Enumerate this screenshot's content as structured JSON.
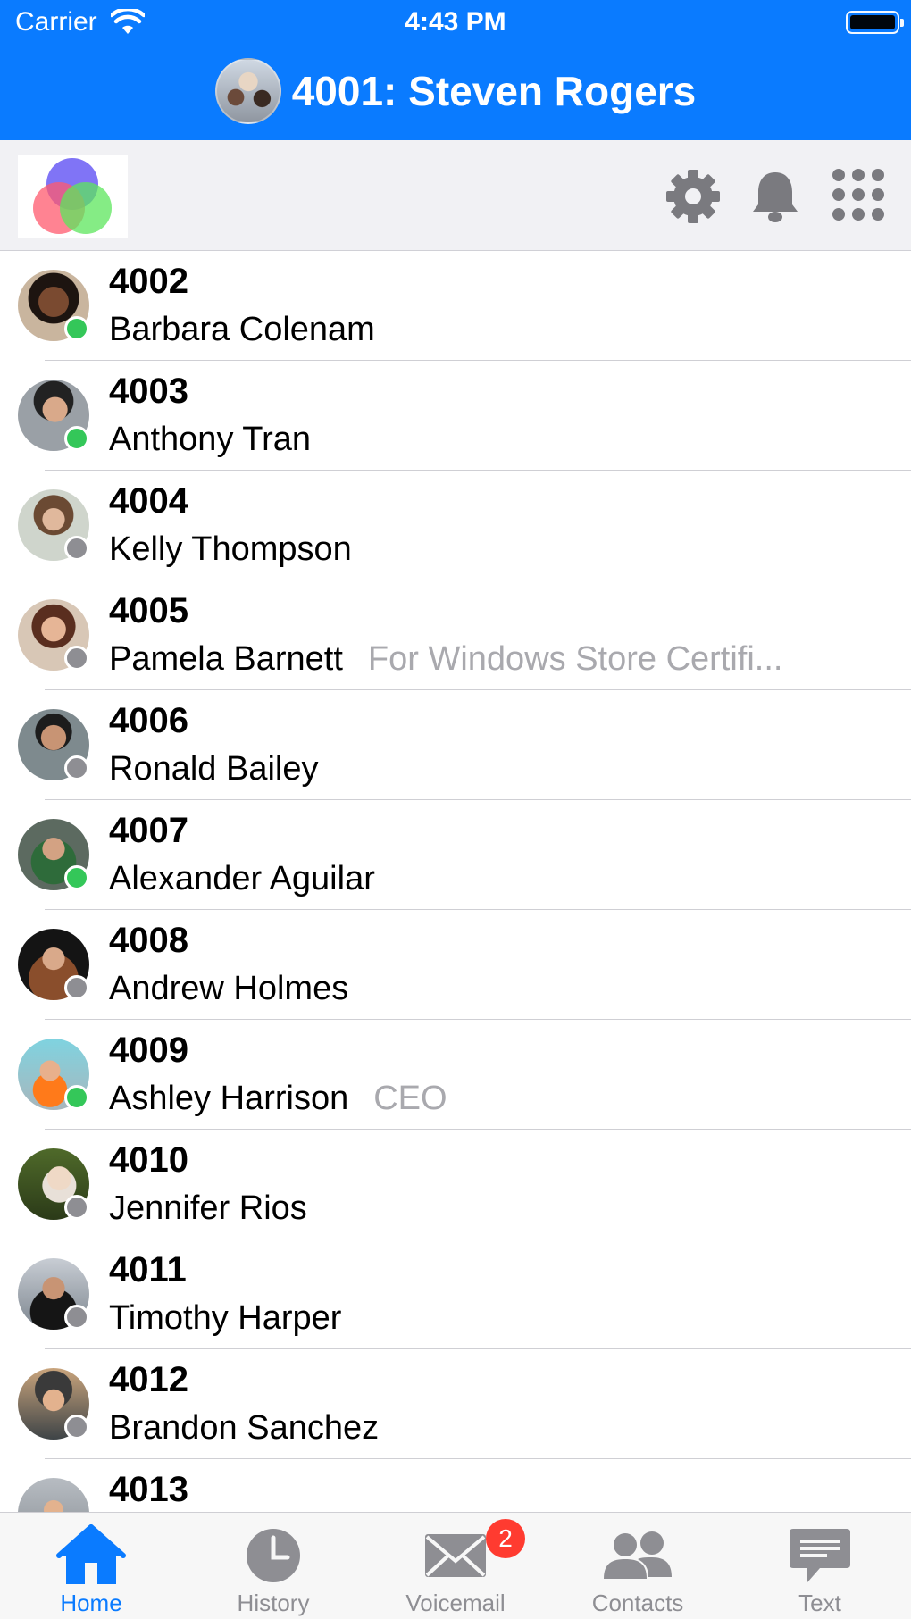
{
  "status_bar": {
    "carrier": "Carrier",
    "time": "4:43 PM"
  },
  "header": {
    "title": "4001: Steven Rogers"
  },
  "toolbar": {
    "icons": [
      "logo-icon",
      "gear-icon",
      "bell-icon",
      "dialpad-icon"
    ]
  },
  "colors": {
    "accent": "#0a7bff",
    "online": "#34c759",
    "offline": "#8e8e93",
    "badge": "#ff3b30"
  },
  "contacts": [
    {
      "ext": "4002",
      "name": "Barbara Colenam",
      "note": "",
      "status": "online"
    },
    {
      "ext": "4003",
      "name": "Anthony Tran",
      "note": "",
      "status": "online"
    },
    {
      "ext": "4004",
      "name": "Kelly Thompson",
      "note": "",
      "status": "offline"
    },
    {
      "ext": "4005",
      "name": "Pamela Barnett",
      "note": "For Windows Store Certifi...",
      "status": "offline"
    },
    {
      "ext": "4006",
      "name": "Ronald Bailey",
      "note": "",
      "status": "offline"
    },
    {
      "ext": "4007",
      "name": "Alexander Aguilar",
      "note": "",
      "status": "online"
    },
    {
      "ext": "4008",
      "name": "Andrew Holmes",
      "note": "",
      "status": "offline"
    },
    {
      "ext": "4009",
      "name": "Ashley Harrison",
      "note": "CEO",
      "status": "online"
    },
    {
      "ext": "4010",
      "name": "Jennifer Rios",
      "note": "",
      "status": "offline"
    },
    {
      "ext": "4011",
      "name": "Timothy Harper",
      "note": "",
      "status": "offline"
    },
    {
      "ext": "4012",
      "name": "Brandon Sanchez",
      "note": "",
      "status": "offline"
    },
    {
      "ext": "4013",
      "name": "",
      "note": "",
      "status": "none"
    }
  ],
  "tabs": [
    {
      "label": "Home",
      "icon": "home-icon",
      "active": true
    },
    {
      "label": "History",
      "icon": "clock-icon",
      "active": false
    },
    {
      "label": "Voicemail",
      "icon": "envelope-icon",
      "active": false,
      "badge": "2"
    },
    {
      "label": "Contacts",
      "icon": "people-icon",
      "active": false
    },
    {
      "label": "Text",
      "icon": "chat-icon",
      "active": false
    }
  ]
}
